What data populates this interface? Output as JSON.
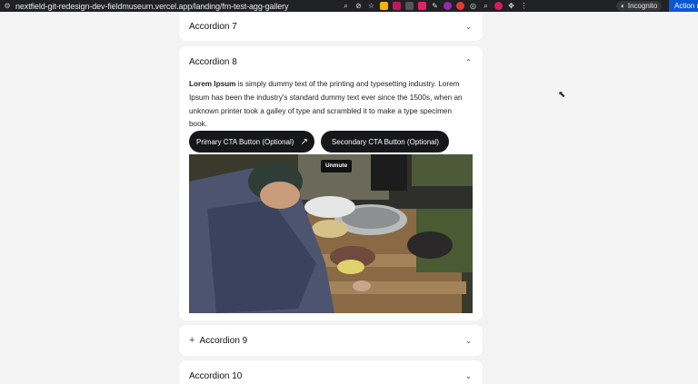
{
  "browser": {
    "url": "nextfield-git-redesign-dev-fieldmuseum.vercel.app/landing/fm-test-agg-gallery",
    "profile_label": "Incognito",
    "action_label": "Action re"
  },
  "accordions": [
    {
      "title": "Accordion 7",
      "expanded": false
    },
    {
      "title": "Accordion 8",
      "expanded": true,
      "body_bold": "Lorem Ipsum",
      "body_text": " is simply dummy text of the printing and typesetting industry. Lorem Ipsum has been the industry's standard dummy text ever since the 1500s, when an unknown printer took a galley of type and scrambled it to make a type specimen book.",
      "primary_cta": "Primary CTA Button (Optional)",
      "secondary_cta": "Secondary CTA Button (Optional)",
      "video": {
        "unmute_label": "Unmute"
      }
    },
    {
      "title": "Accordion 9",
      "expanded": false
    },
    {
      "title": "Accordion 10",
      "expanded": false
    }
  ],
  "colors": {
    "page_bg": "#f3f3f4",
    "card_bg": "#ffffff",
    "button_bg": "#15171a",
    "browser_bar": "#202124"
  }
}
